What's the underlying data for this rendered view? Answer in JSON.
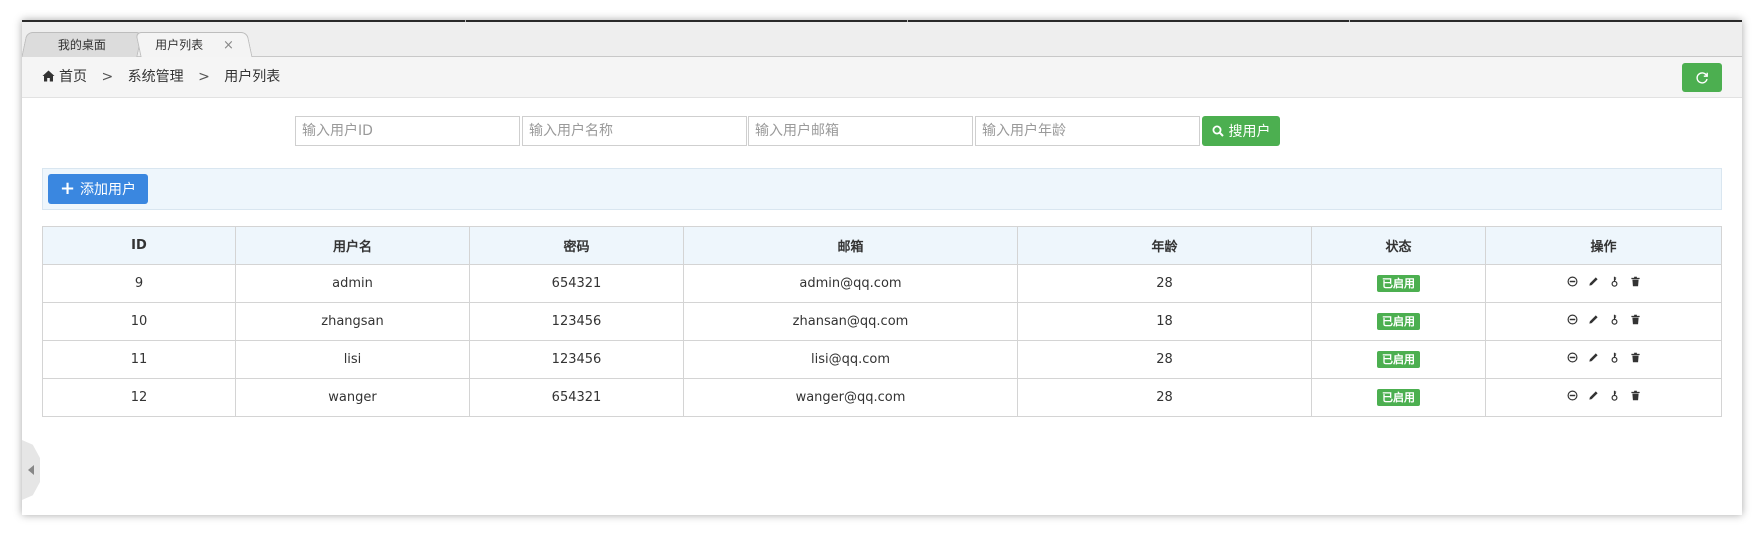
{
  "tabs": [
    {
      "label": "我的桌面"
    },
    {
      "label": "用户列表",
      "close": "×"
    }
  ],
  "breadcrumb": {
    "home": "首页",
    "sep": ">",
    "level1": "系统管理",
    "level2": "用户列表"
  },
  "search": {
    "id_placeholder": "输入用户ID",
    "name_placeholder": "输入用户名称",
    "email_placeholder": "输入用户邮箱",
    "age_placeholder": "输入用户年龄",
    "button_label": "搜用户"
  },
  "toolbar": {
    "add_label": "添加用户"
  },
  "table": {
    "headers": [
      "ID",
      "用户名",
      "密码",
      "邮箱",
      "年龄",
      "状态",
      "操作"
    ],
    "rows": [
      {
        "id": "9",
        "username": "admin",
        "password": "654321",
        "email": "admin@qq.com",
        "age": "28",
        "status": "已启用"
      },
      {
        "id": "10",
        "username": "zhangsan",
        "password": "123456",
        "email": "zhansan@qq.com",
        "age": "18",
        "status": "已启用"
      },
      {
        "id": "11",
        "username": "lisi",
        "password": "123456",
        "email": "lisi@qq.com",
        "age": "28",
        "status": "已启用"
      },
      {
        "id": "12",
        "username": "wanger",
        "password": "654321",
        "email": "wanger@qq.com",
        "age": "28",
        "status": "已启用"
      }
    ],
    "row_actions": [
      "disable-icon",
      "edit-icon",
      "key-icon",
      "trash-icon"
    ]
  },
  "colors": {
    "success": "#4caf50",
    "primary": "#3a87e0",
    "header_bg": "#eef6fc"
  }
}
